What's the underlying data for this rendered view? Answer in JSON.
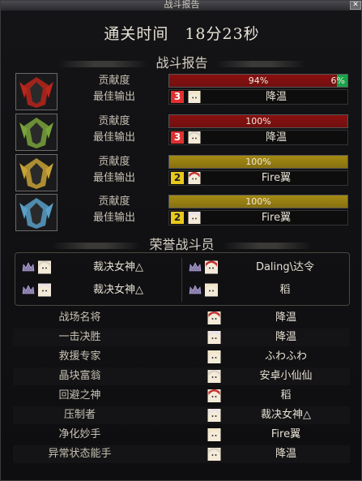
{
  "window": {
    "title": "战斗报告"
  },
  "header": {
    "clear_time": "通关时间　18分23秒"
  },
  "sections": {
    "battle_report": "战斗报告",
    "honor": "荣誉战斗员"
  },
  "labels": {
    "contribution": "贡献度",
    "best_output": "最佳输出"
  },
  "bosses": [
    {
      "contribution_pct": "94%",
      "contribution_extra": "6%",
      "contribution_value": 0.94,
      "extra_value": 0.06,
      "bar_color": "#8a1010",
      "extra_color": "#1aa24a",
      "best_rank": "3",
      "rank_color": "#e03030",
      "best_player": "降温",
      "portrait_color": "#b8261c"
    },
    {
      "contribution_pct": "100%",
      "contribution_value": 1.0,
      "bar_color": "#8a1010",
      "best_rank": "3",
      "rank_color": "#e03030",
      "best_player": "降温",
      "portrait_color": "#7aa33b"
    },
    {
      "contribution_pct": "100%",
      "contribution_value": 1.0,
      "bar_color": "#a58a12",
      "best_rank": "2",
      "rank_color": "#e8c81c",
      "best_player": "Fire翼",
      "portrait_color": "#c7a236"
    },
    {
      "contribution_pct": "100%",
      "contribution_value": 1.0,
      "bar_color": "#a58a12",
      "best_rank": "2",
      "rank_color": "#e8c81c",
      "best_player": "Fire翼",
      "portrait_color": "#5aa0c8"
    }
  ],
  "honor_members": [
    {
      "name": "裁决女神△"
    },
    {
      "name": "Daling\\达令"
    },
    {
      "name": "裁决女神△"
    },
    {
      "name": "稻"
    }
  ],
  "awards": [
    {
      "title": "战场名将",
      "player": "降温"
    },
    {
      "title": "一击决胜",
      "player": "降温"
    },
    {
      "title": "救援专家",
      "player": "ふわふわ"
    },
    {
      "title": "晶块富翁",
      "player": "安卓小仙仙"
    },
    {
      "title": "回避之神",
      "player": "稻"
    },
    {
      "title": "压制者",
      "player": "裁决女神△"
    },
    {
      "title": "净化妙手",
      "player": "Fire翼"
    },
    {
      "title": "异常状态能手",
      "player": "降温"
    }
  ],
  "icons": {
    "boss_portrait": "boss-portrait-icon",
    "avatar": "avatar-icon",
    "crown": "crown-icon",
    "close": "close-icon"
  }
}
